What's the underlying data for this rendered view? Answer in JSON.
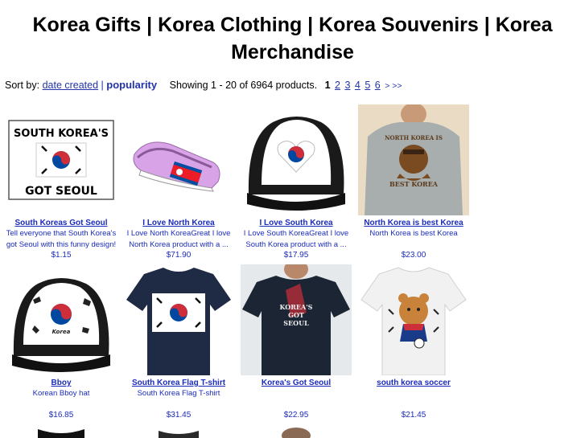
{
  "page": {
    "title_line1": "Korea Gifts | Korea Clothing | Korea Souvenirs | Korea",
    "title_line2": "Merchandise"
  },
  "sortbar": {
    "sort_label": "Sort by:",
    "date_created": "date created",
    "separator": "|",
    "popularity": "popularity",
    "showing": "Showing 1 - 20 of 6964 products.",
    "pages": [
      "1",
      "2",
      "3",
      "4",
      "5",
      "6"
    ],
    "next": "> >>"
  },
  "products": [
    {
      "name": "South Koreas Got Seoul",
      "desc": "Tell everyone that South Korea's got Seoul with this funny design!",
      "price": "$1.15",
      "thumb_text": [
        "SOUTH KOREA'S",
        "GOT SEOUL"
      ]
    },
    {
      "name": "I Love North Korea",
      "desc": "I Love North KoreaGreat I love North Korea product with a ...",
      "price": "$71.90"
    },
    {
      "name": "I Love South Korea",
      "desc": "I Love South KoreaGreat I love South Korea product with a ...",
      "price": "$17.95"
    },
    {
      "name": "North Korea is best Korea",
      "desc": "North Korea is best Korea",
      "price": "$23.00",
      "thumb_text": [
        "NORTH KOREA IS",
        "BEST KOREA"
      ]
    },
    {
      "name": "Bboy",
      "desc": "Korean Bboy hat",
      "price": "$16.85",
      "thumb_text": [
        "Korea"
      ]
    },
    {
      "name": "South Korea Flag T-shirt",
      "desc": "South Korea Flag T-shirt",
      "price": "$31.45"
    },
    {
      "name": "Korea's Got Seoul",
      "desc": "",
      "price": "$22.95",
      "thumb_text": [
        "KOREA'S",
        "GOT",
        "SEOUL"
      ]
    },
    {
      "name": "south korea soccer",
      "desc": "",
      "price": "$21.45"
    }
  ],
  "colors": {
    "link": "#1a2bbb",
    "flag_red": "#cd2e3a",
    "flag_blue": "#0047a0"
  }
}
